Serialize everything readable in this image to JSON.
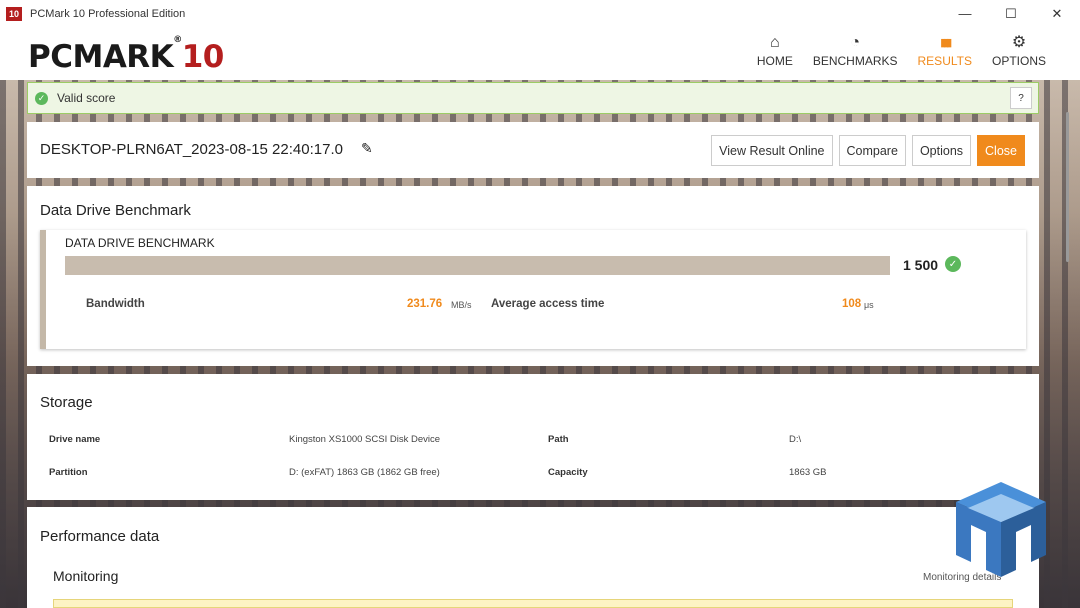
{
  "window": {
    "app_icon_text": "10",
    "title": "PCMark 10 Professional Edition",
    "minimize_glyph": "—",
    "maximize_glyph": "☐",
    "close_glyph": "✕"
  },
  "header": {
    "logo_main": "PCMARK",
    "logo_reg": "®",
    "logo_num": "10",
    "nav": [
      {
        "label": "HOME",
        "icon": "home-icon",
        "glyph": "⌂",
        "active": false
      },
      {
        "label": "BENCHMARKS",
        "icon": "gauge-icon",
        "glyph": "◔",
        "active": false
      },
      {
        "label": "RESULTS",
        "icon": "bar-chart-icon",
        "glyph": "▮▮▮",
        "active": true
      },
      {
        "label": "OPTIONS",
        "icon": "gear-icon",
        "glyph": "⚙",
        "active": false
      }
    ]
  },
  "valid": {
    "text": "Valid score",
    "help": "?",
    "check_glyph": "✓"
  },
  "result": {
    "name": "DESKTOP-PLRN6AT_2023-08-15 22:40:17.0",
    "pencil_glyph": "✎",
    "buttons": {
      "view_online": "View Result Online",
      "compare": "Compare",
      "options": "Options",
      "close": "Close"
    }
  },
  "ddb": {
    "section_title": "Data Drive Benchmark",
    "card_label": "DATA DRIVE BENCHMARK",
    "score": "1 500",
    "score_fraction": 0.9,
    "check_glyph": "✓",
    "bandwidth_label": "Bandwidth",
    "bandwidth_value": "231.76",
    "bandwidth_unit": "MB/s",
    "access_label": "Average access time",
    "access_value": "108",
    "access_unit": "μs"
  },
  "storage": {
    "section_title": "Storage",
    "drive_name_label": "Drive name",
    "drive_name_value": "Kingston XS1000 SCSI Disk Device",
    "path_label": "Path",
    "path_value": "D:\\",
    "partition_label": "Partition",
    "partition_value": "D: (exFAT) 1863 GB (1862 GB free)",
    "capacity_label": "Capacity",
    "capacity_value": "1863 GB"
  },
  "performance": {
    "section_title": "Performance data",
    "monitoring_title": "Monitoring",
    "monitoring_link": "Monitoring details"
  },
  "colors": {
    "accent": "#f08a1c",
    "brand_red": "#b41e1e",
    "valid_green": "#5cb85c"
  }
}
